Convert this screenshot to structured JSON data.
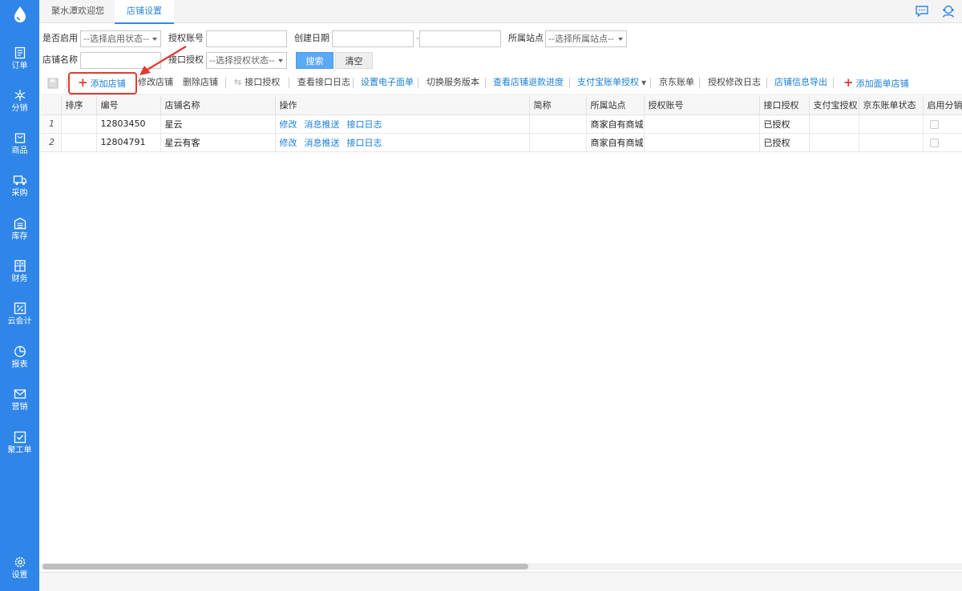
{
  "sidebar": {
    "logo_icon": "droplet-logo-icon",
    "items": [
      {
        "label": "订单",
        "icon": "document-icon"
      },
      {
        "label": "分销",
        "icon": "snowflake-icon"
      },
      {
        "label": "商品",
        "icon": "bag-icon"
      },
      {
        "label": "采购",
        "icon": "truck-icon"
      },
      {
        "label": "库存",
        "icon": "warehouse-icon"
      },
      {
        "label": "财务",
        "icon": "calculator-icon"
      },
      {
        "label": "云会计",
        "icon": "percent-box-icon"
      },
      {
        "label": "报表",
        "icon": "pie-chart-icon"
      },
      {
        "label": "营销",
        "icon": "mail-icon"
      },
      {
        "label": "聚工单",
        "icon": "checkbox-icon"
      }
    ],
    "settings_label": "设置"
  },
  "tabs": [
    {
      "label": "聚水潭欢迎您"
    },
    {
      "label": "店铺设置",
      "active": true
    }
  ],
  "filters": {
    "enabled_label": "是否启用",
    "enabled_placeholder": "--选择启用状态--",
    "auth_account_label": "授权账号",
    "create_date_label": "创建日期",
    "date_sep": "-",
    "station_label": "所属站点",
    "station_placeholder": "--选择所属站点--",
    "shop_name_label": "店铺名称",
    "api_auth_label": "接口授权",
    "api_auth_placeholder": "--选择授权状态--",
    "search_label": "搜索",
    "clear_label": "清空"
  },
  "toolbar": {
    "add_shop": "添加店铺",
    "edit_shop": "修改店铺",
    "delete_shop": "删除店铺",
    "api_auth": "接口授权",
    "view_api_log": "查看接口日志",
    "set_e_waybill": "设置电子面单",
    "switch_version": "切换服务版本",
    "view_refund": "查看店铺退款进度",
    "alipay_auth": "支付宝账单授权",
    "jd_bill": "京东账单",
    "auth_log": "授权修改日志",
    "export_info": "店铺信息导出",
    "add_waybill_shop": "添加面单店铺"
  },
  "table": {
    "columns": [
      "排序",
      "编号",
      "店铺名称",
      "操作",
      "简称",
      "所属站点",
      "授权账号",
      "接口授权",
      "支付宝授权",
      "京东账单状态",
      "启用分销"
    ],
    "rows": [
      {
        "num": "1",
        "id": "12803450",
        "name": "星云",
        "actions": [
          "修改",
          "消息推送",
          "接口日志"
        ],
        "abbr": "",
        "station": "商家自有商城",
        "auth_account": "",
        "api_auth": "已授权",
        "alipay": "",
        "jd": ""
      },
      {
        "num": "2",
        "id": "12804791",
        "name": "星云有客",
        "actions": [
          "修改",
          "消息推送",
          "接口日志"
        ],
        "abbr": "",
        "station": "商家自有商城",
        "auth_account": "",
        "api_auth": "已授权",
        "alipay": "",
        "jd": ""
      }
    ]
  },
  "colors": {
    "sidebar": "#2f86e8",
    "link": "#1a7fd6",
    "highlight": "#e23b2e",
    "search_button": "#5aa9f5"
  }
}
